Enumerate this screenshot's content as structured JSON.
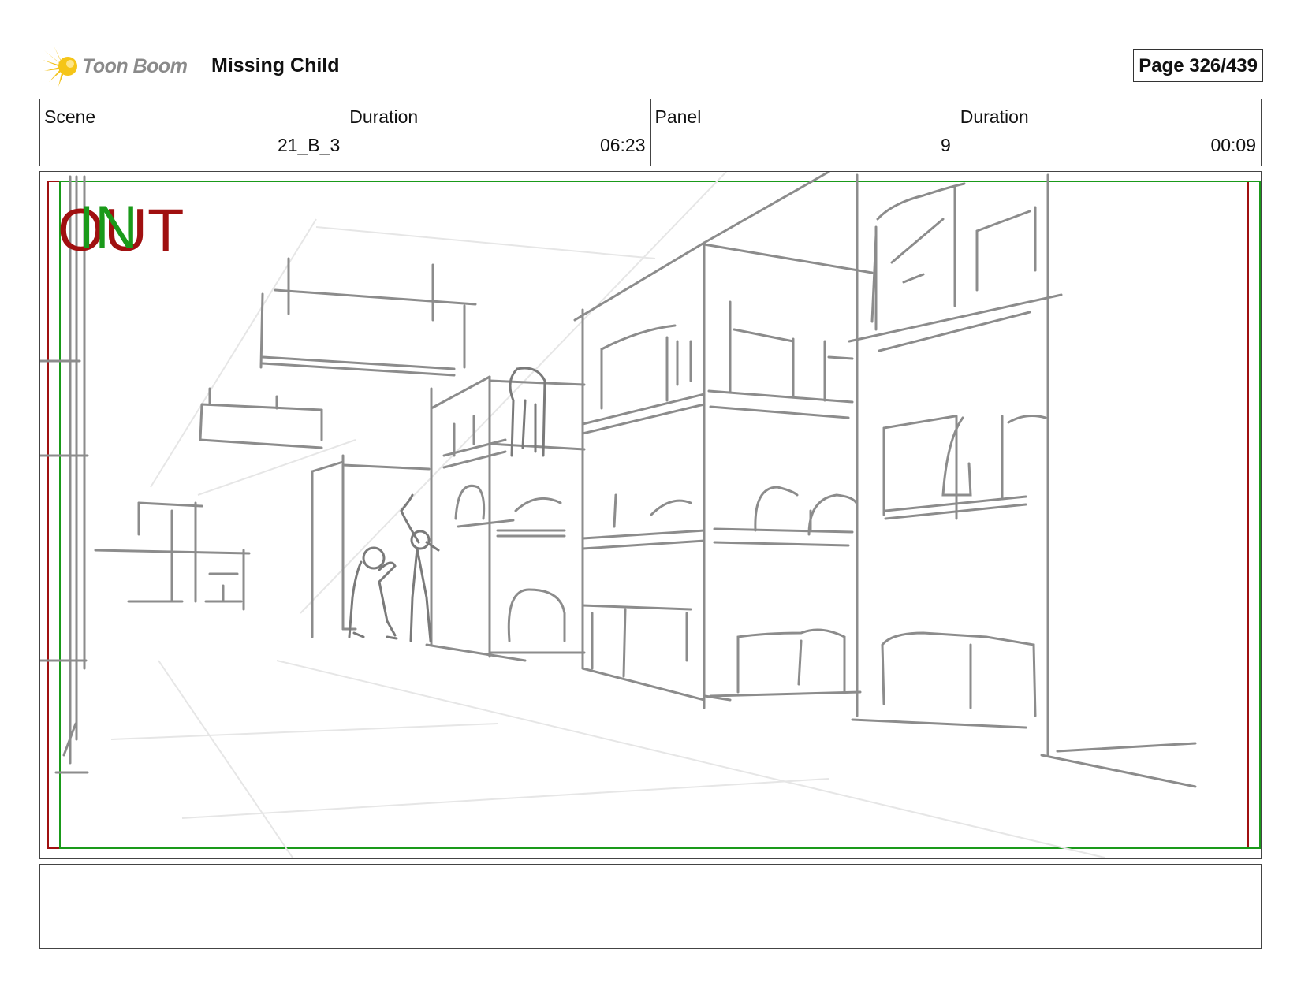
{
  "header": {
    "logo_text": "Toon Boom",
    "project_title": "Missing Child",
    "page_label": "Page 326/439"
  },
  "info": {
    "scene_label": "Scene",
    "scene_value": "21_B_3",
    "scene_duration_label": "Duration",
    "scene_duration_value": "06:23",
    "panel_label": "Panel",
    "panel_value": "9",
    "panel_duration_label": "Duration",
    "panel_duration_value": "00:09"
  },
  "panel": {
    "out_mark": "OUT",
    "in_mark": "IN",
    "out_color": "#a01010",
    "in_color": "#1a9a1a",
    "sketch_color": "#8c8c8c"
  },
  "notes": {
    "text": ""
  }
}
